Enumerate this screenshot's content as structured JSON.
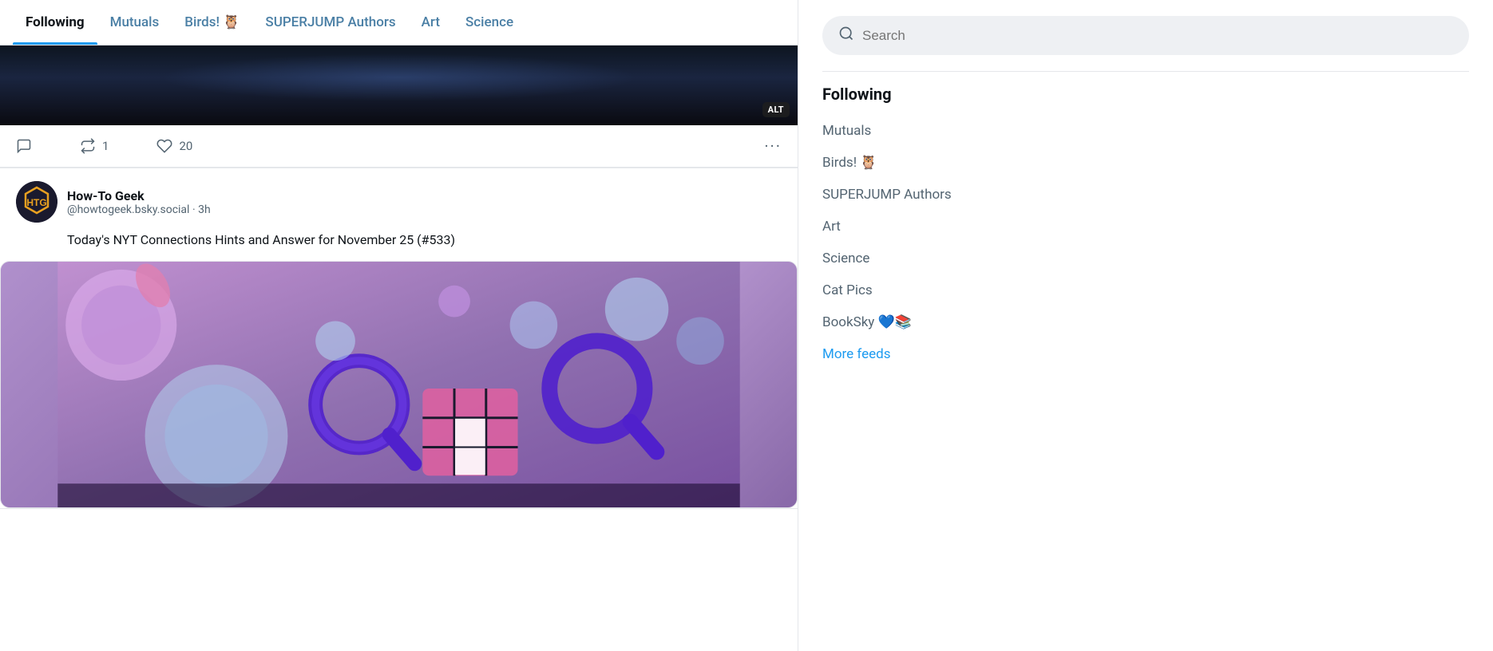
{
  "tabs": [
    {
      "id": "following",
      "label": "Following",
      "active": true
    },
    {
      "id": "mutuals",
      "label": "Mutuals",
      "active": false
    },
    {
      "id": "birds",
      "label": "Birds! 🦉",
      "active": false
    },
    {
      "id": "superjump",
      "label": "SUPERJUMP Authors",
      "active": false
    },
    {
      "id": "art",
      "label": "Art",
      "active": false
    },
    {
      "id": "science",
      "label": "Science",
      "active": false
    }
  ],
  "post_top": {
    "alt_badge": "ALT",
    "actions": {
      "comment_label": "",
      "repost_count": "1",
      "like_count": "20",
      "more": "···"
    }
  },
  "post_main": {
    "author": {
      "name": "How-To Geek",
      "handle": "@howtogeek.bsky.social",
      "time_ago": "3h",
      "avatar_text": "HTG"
    },
    "text": "Today's NYT Connections Hints and Answer for November 25 (#533)"
  },
  "sidebar": {
    "search_placeholder": "Search",
    "section_title": "Following",
    "feeds": [
      {
        "label": "Mutuals"
      },
      {
        "label": "Birds! 🦉"
      },
      {
        "label": "SUPERJUMP Authors"
      },
      {
        "label": "Art"
      },
      {
        "label": "Science"
      },
      {
        "label": "Cat Pics"
      },
      {
        "label": "BookSky 💙📚"
      }
    ],
    "more_feeds_label": "More feeds"
  }
}
